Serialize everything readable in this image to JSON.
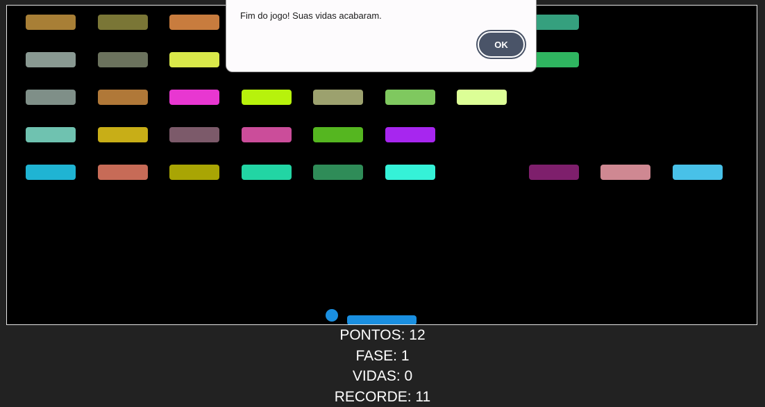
{
  "dialog": {
    "message": "Fim do jogo! Suas vidas acabaram.",
    "ok_label": "OK"
  },
  "hud": {
    "pontos": "PONTOS: 12",
    "fase": "FASE: 1",
    "vidas": "VIDAS: 0",
    "recorde": "RECORDE: 11"
  },
  "colors": {
    "background": "#222222",
    "canvas": "#000000",
    "ball": "#1a8fe0",
    "paddle": "#1a8fe0",
    "ok_button": "#4a5468"
  },
  "bricks": [
    {
      "row": 0,
      "col": 0,
      "color": "#a87f36"
    },
    {
      "row": 0,
      "col": 1,
      "color": "#7a7636"
    },
    {
      "row": 0,
      "col": 2,
      "color": "#c87c3e"
    },
    {
      "row": 0,
      "col": 7,
      "color": "#35a07e"
    },
    {
      "row": 1,
      "col": 0,
      "color": "#899992"
    },
    {
      "row": 1,
      "col": 1,
      "color": "#6b725d"
    },
    {
      "row": 1,
      "col": 2,
      "color": "#d9e84a"
    },
    {
      "row": 1,
      "col": 7,
      "color": "#2fb560"
    },
    {
      "row": 2,
      "col": 0,
      "color": "#7f8f88"
    },
    {
      "row": 2,
      "col": 1,
      "color": "#b07838"
    },
    {
      "row": 2,
      "col": 2,
      "color": "#e837d1"
    },
    {
      "row": 2,
      "col": 3,
      "color": "#b7f20c"
    },
    {
      "row": 2,
      "col": 4,
      "color": "#9ca16e"
    },
    {
      "row": 2,
      "col": 5,
      "color": "#7fc85f"
    },
    {
      "row": 2,
      "col": 6,
      "color": "#dcfe96"
    },
    {
      "row": 3,
      "col": 0,
      "color": "#6fc2b0"
    },
    {
      "row": 3,
      "col": 1,
      "color": "#c8ae17"
    },
    {
      "row": 3,
      "col": 2,
      "color": "#7c5a6a"
    },
    {
      "row": 3,
      "col": 3,
      "color": "#cb4d9a"
    },
    {
      "row": 3,
      "col": 4,
      "color": "#55b620"
    },
    {
      "row": 3,
      "col": 5,
      "color": "#a726ef"
    },
    {
      "row": 4,
      "col": 0,
      "color": "#1fb4d3"
    },
    {
      "row": 4,
      "col": 1,
      "color": "#c76b57"
    },
    {
      "row": 4,
      "col": 2,
      "color": "#a9a504"
    },
    {
      "row": 4,
      "col": 3,
      "color": "#22d5a4"
    },
    {
      "row": 4,
      "col": 4,
      "color": "#2f8c58"
    },
    {
      "row": 4,
      "col": 5,
      "color": "#35f2d8"
    },
    {
      "row": 4,
      "col": 7,
      "color": "#7e1f6c"
    },
    {
      "row": 4,
      "col": 8,
      "color": "#cf8892"
    },
    {
      "row": 4,
      "col": 9,
      "color": "#48c1e8"
    }
  ]
}
